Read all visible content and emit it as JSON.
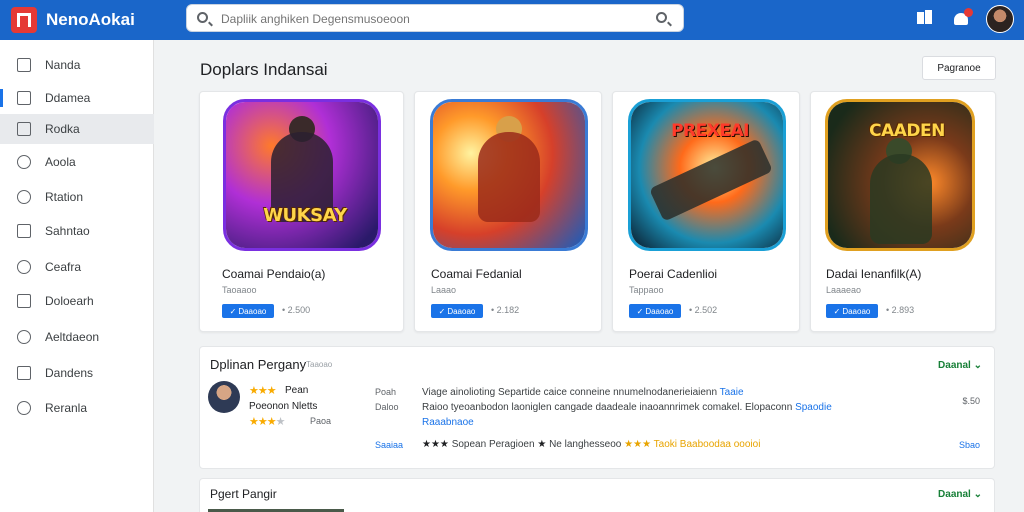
{
  "app": {
    "title": "NenoAokai",
    "brand_color": "#1a66c9"
  },
  "search": {
    "placeholder": "Dapliik anghiken Degensmusoeoon"
  },
  "sidebar": {
    "items": [
      {
        "label": "Nanda",
        "icon": "laptop-icon"
      },
      {
        "label": "Ddamea",
        "icon": "square-icon"
      },
      {
        "label": "Rodka",
        "icon": "image-icon"
      },
      {
        "label": "Aoola",
        "icon": "person-icon"
      },
      {
        "label": "Rtation",
        "icon": "globe-icon"
      },
      {
        "label": "Sahntao",
        "icon": "document-icon"
      },
      {
        "label": "Ceafra",
        "icon": "gear-icon"
      },
      {
        "label": "Doloearh",
        "icon": "list-icon"
      },
      {
        "label": "Aeltdaeon",
        "icon": "info-icon"
      },
      {
        "label": "Dandens",
        "icon": "pencil-icon"
      },
      {
        "label": "Reranla",
        "icon": "user-icon"
      }
    ]
  },
  "main": {
    "title": "Doplars Indansai",
    "programs_button": "Pagranoe"
  },
  "cards": [
    {
      "art_text": "WUKSAY",
      "title": "Coamai Pendaio(a)",
      "subtitle": "Taoaaoo",
      "button": "Daaoao",
      "count": "• 2.500",
      "colors": [
        "#7a1fd6",
        "#e05a1a",
        "#2a2a6a"
      ]
    },
    {
      "art_text": "",
      "title": "Coamai Fedanial",
      "subtitle": "Laaao",
      "button": "Daaoao",
      "count": "• 2.182",
      "colors": [
        "#e6a22a",
        "#c2301a",
        "#3a6fc0"
      ]
    },
    {
      "art_text": "PREXEAI",
      "title": "Poerai Cadenlioi",
      "subtitle": "Tappaoo",
      "button": "Daaoao",
      "count": "• 2.502",
      "colors": [
        "#ff6a1a",
        "#1ad6e0",
        "#1a2a3a"
      ]
    },
    {
      "art_text": "CAADEN",
      "title": "Dadai Ienanfilk(A)",
      "subtitle": "Laaaeao",
      "button": "Daaoao",
      "count": "• 2.893",
      "colors": [
        "#1a3a2a",
        "#e05a1a",
        "#f0c040"
      ]
    }
  ],
  "reviews": {
    "title": "Dplinan Pergany",
    "subtitle": "Taaoao",
    "action": "Daanal ⌄",
    "user_name": "Pean",
    "user_sub": "Poeonon Nletts",
    "rating_label": "Paoa",
    "col_labels": [
      "Poah",
      "Daloo"
    ],
    "text_line1": "Viage ainolioting Separtide caice conneine nnumelnodanerieiaienn",
    "text_line1_link": "Taaie",
    "text_line2": "Raioo tyeoanbodon laoniglen cangade daadeale inaoannrimek comakel. Elopaconn",
    "text_line2_link": "Spaodie",
    "text_line3": "Raaabnaoe",
    "right_value": "$.50",
    "foot_left": "Saaiaa",
    "foot_text": "Sopean Peragioen",
    "foot_text2": "Ne langhesseoo",
    "foot_gold": "Taoki Baaboodaa oooioi",
    "foot_right": "Sbao"
  },
  "reviews2": {
    "title": "Pgert Pangir",
    "action": "Daanal ⌄"
  }
}
